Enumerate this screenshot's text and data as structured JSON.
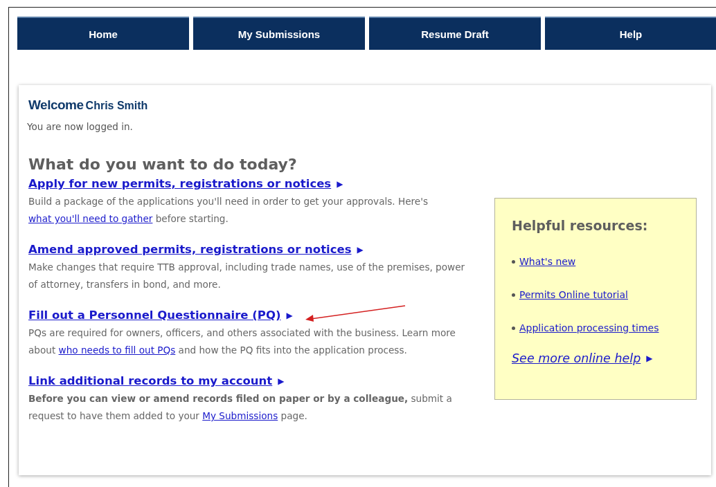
{
  "nav": [
    {
      "label": "Home"
    },
    {
      "label": "My Submissions"
    },
    {
      "label": "Resume Draft"
    },
    {
      "label": "Help"
    }
  ],
  "welcome": {
    "greeting": "Welcome",
    "name": "Chris Smith",
    "status": "You are now logged in."
  },
  "heading": "What do you want to do today?",
  "tasks": [
    {
      "title": "Apply for new permits, registrations or notices",
      "arrow": "▶",
      "annotated": false,
      "before": "Build a package of the applications you'll need in order to get your approvals. Here's ",
      "link": "what you'll need to gather",
      "after": " before starting."
    },
    {
      "title": "Amend approved permits, registrations or notices",
      "arrow": "▶",
      "annotated": false,
      "before": "Make changes that require TTB approval, including trade names, use of the premises, power of attorney, transfers in bond, and more."
    },
    {
      "title": "Fill out a Personnel Questionnaire (PQ)",
      "arrow": "▶",
      "annotated": true,
      "before": "PQs are required for owners, officers, and others associated with the business. Learn more about ",
      "link": "who needs to fill out PQs",
      "after": " and how the PQ fits into the application process."
    },
    {
      "title": "Link additional records to my account",
      "arrow": "▶",
      "annotated": false,
      "before": "**Before you can view or amend records filed on paper or by a colleague,** submit a request to have them added to your ",
      "link": "My Submissions",
      "after": " page."
    }
  ],
  "resources": {
    "title": "Helpful resources:",
    "links": [
      "What's new",
      "Permits Online tutorial",
      "Application processing times"
    ],
    "more": "See more online help",
    "arrow": "▶"
  }
}
